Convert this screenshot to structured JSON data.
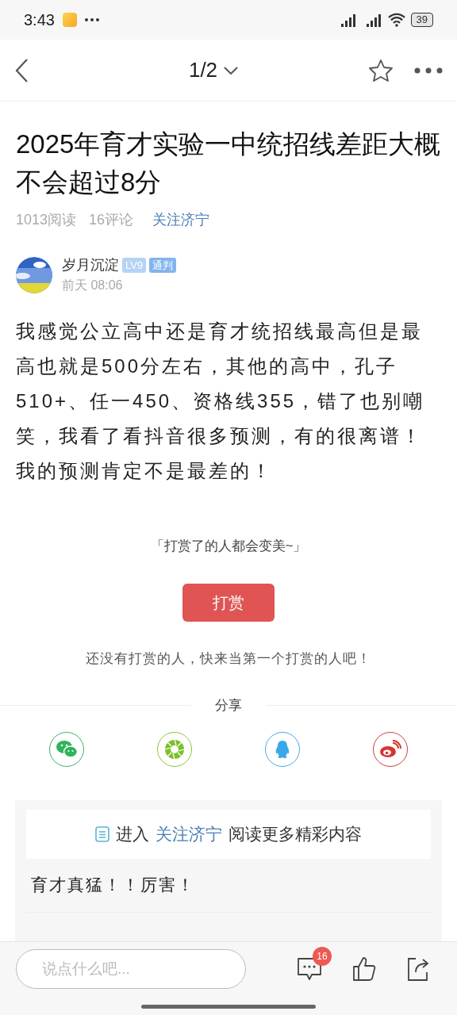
{
  "status_bar": {
    "time": "3:43",
    "battery": "39"
  },
  "nav": {
    "page_indicator": "1/2"
  },
  "article": {
    "title": "2025年育才实验一中统招线差距大概不会超过8分",
    "reads": "1013阅读",
    "comments": "16评论",
    "forum": "关注济宁"
  },
  "author": {
    "name": "岁月沉淀",
    "level": "LV9",
    "rank": "通判",
    "time": "前天 08:06"
  },
  "body": "我感觉公立高中还是育才统招线最高但是最高也就是500分左右，其他的高中，孔子510+、任一450、资格线355，错了也别嘲笑，我看了看抖音很多预测，有的很离谱！我的预测肯定不是最差的！",
  "reward": {
    "slogan": "「打赏了的人都会变美~」",
    "button": "打赏",
    "note": "还没有打赏的人，快来当第一个打赏的人吧！"
  },
  "share": {
    "label": "分享",
    "targets": [
      {
        "kind": "wechat"
      },
      {
        "kind": "moments"
      },
      {
        "kind": "qq"
      },
      {
        "kind": "weibo"
      }
    ]
  },
  "forum_link": {
    "prefix": "进入",
    "forum": "关注济宁",
    "suffix": "阅读更多精彩内容"
  },
  "comments": [
    {
      "text": "育才真猛！！厉害！"
    }
  ],
  "bottom_bar": {
    "placeholder": "说点什么吧...",
    "comment_count": "16"
  }
}
